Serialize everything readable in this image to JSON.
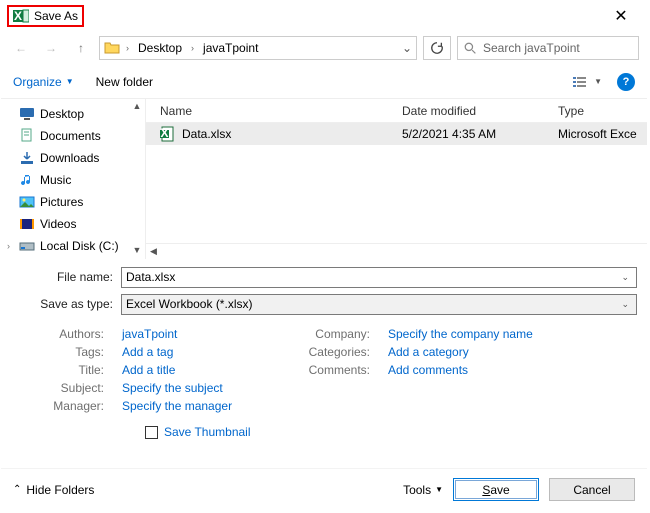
{
  "title": "Save As",
  "breadcrumb": {
    "part1": "Desktop",
    "part2": "javaTpoint"
  },
  "search": {
    "placeholder": "Search javaTpoint"
  },
  "toolbar": {
    "organize": "Organize",
    "newfolder": "New folder"
  },
  "tree": {
    "items": [
      {
        "label": "Desktop",
        "icon": "desktop"
      },
      {
        "label": "Documents",
        "icon": "documents"
      },
      {
        "label": "Downloads",
        "icon": "downloads"
      },
      {
        "label": "Music",
        "icon": "music"
      },
      {
        "label": "Pictures",
        "icon": "pictures"
      },
      {
        "label": "Videos",
        "icon": "videos"
      },
      {
        "label": "Local Disk (C:)",
        "icon": "drive"
      }
    ]
  },
  "columns": {
    "name": "Name",
    "date": "Date modified",
    "type": "Type"
  },
  "files": [
    {
      "name": "Data.xlsx",
      "date": "5/2/2021 4:35 AM",
      "type": "Microsoft Exce"
    }
  ],
  "form": {
    "filename_label": "File name:",
    "filename_value": "Data.xlsx",
    "savetype_label": "Save as type:",
    "savetype_value": "Excel Workbook (*.xlsx)"
  },
  "meta": {
    "authors_label": "Authors:",
    "authors_value": "javaTpoint",
    "tags_label": "Tags:",
    "tags_value": "Add a tag",
    "title_label": "Title:",
    "title_value": "Add a title",
    "subject_label": "Subject:",
    "subject_value": "Specify the subject",
    "manager_label": "Manager:",
    "manager_value": "Specify the manager",
    "company_label": "Company:",
    "company_value": "Specify the company name",
    "categories_label": "Categories:",
    "categories_value": "Add a category",
    "comments_label": "Comments:",
    "comments_value": "Add comments"
  },
  "thumb": {
    "label": "Save Thumbnail"
  },
  "footer": {
    "hide": "Hide Folders",
    "tools": "Tools",
    "save": "Save",
    "cancel": "Cancel"
  }
}
